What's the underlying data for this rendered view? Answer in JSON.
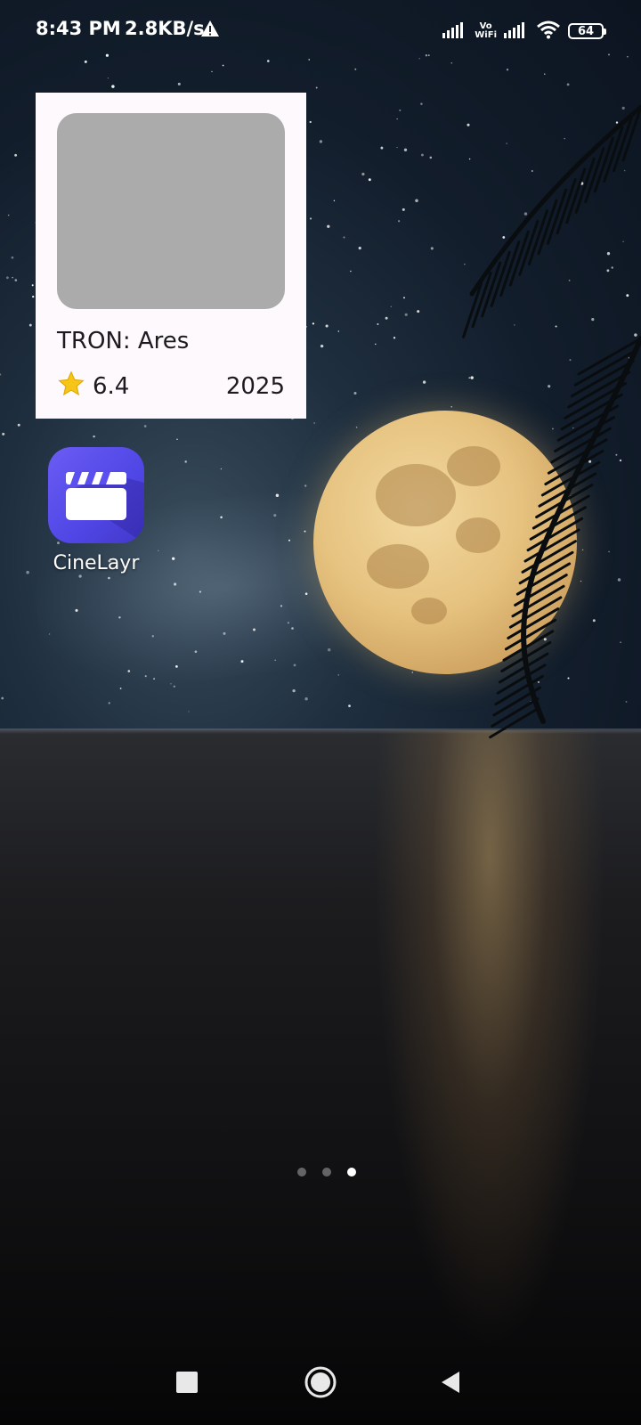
{
  "status_bar": {
    "time": "8:43 PM",
    "net_speed": "2.8KB/s",
    "volte_top": "Vo",
    "volte_bottom": "WiFi",
    "battery_level": "64"
  },
  "widget": {
    "title": "TRON: Ares",
    "rating": "6.4",
    "year": "2025"
  },
  "home": {
    "app_label": "CineLayr",
    "pages": 3,
    "active_page": 3
  },
  "colors": {
    "app_icon": "#5b4ff0",
    "widget_bg": "#fdf9fd",
    "poster_placeholder": "#ababab",
    "star": "#f5c518"
  }
}
